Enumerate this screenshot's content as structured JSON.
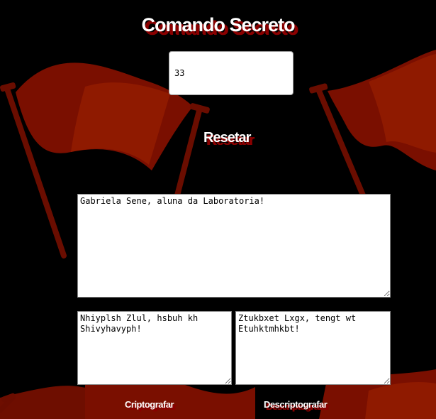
{
  "page": {
    "title": "Comando Secreto"
  },
  "offset": {
    "value": "33"
  },
  "reset_button": {
    "label": "Resetar"
  },
  "message": {
    "value": "Gabriela Sene, aluna da Laboratoria!"
  },
  "encrypted": {
    "value": "Nhiyplsh Zlul, hsbuh kh Shivyhavyph!"
  },
  "decrypted": {
    "value": "Ztukbxet Lxgx, tengt wt Etuhktmhkbt!"
  },
  "actions": {
    "encrypt_label": "Criptografar",
    "decrypt_label": "Descriptografar"
  },
  "colors": {
    "background": "#000000",
    "flag": "#8a1200",
    "title_shadow": "#8a0000"
  }
}
